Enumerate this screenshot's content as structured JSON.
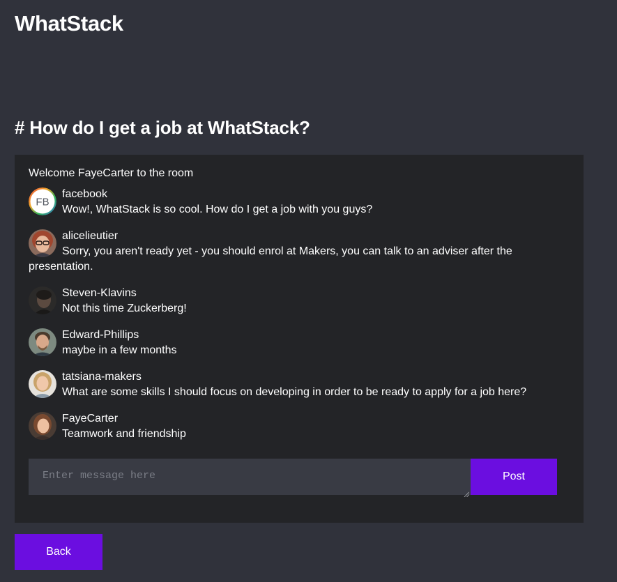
{
  "app": {
    "title": "WhatStack"
  },
  "room": {
    "title": "# How do I get a job at WhatStack?"
  },
  "chat": {
    "welcome": "Welcome FayeCarter to the room",
    "messages": [
      {
        "user": "facebook",
        "text": "Wow!, WhatStack is so cool. How do I get a job with you guys?",
        "avatar": "fb-logo-avatar",
        "avatar_text": "FB"
      },
      {
        "user": "alicelieutier",
        "text": "Sorry, you aren't ready yet - you should enrol at Makers, you can talk to an adviser after the presentation.",
        "avatar": "user-photo-avatar"
      },
      {
        "user": "Steven-Klavins",
        "text": "Not this time Zuckerberg!",
        "avatar": "user-photo-avatar"
      },
      {
        "user": "Edward-Phillips",
        "text": "maybe in a few months",
        "avatar": "user-photo-avatar"
      },
      {
        "user": "tatsiana-makers",
        "text": "What are some skills I should focus on developing in order to be ready to apply for a job here?",
        "avatar": "user-photo-avatar"
      },
      {
        "user": "FayeCarter",
        "text": "Teamwork and friendship",
        "avatar": "user-photo-avatar"
      }
    ]
  },
  "composer": {
    "placeholder": "Enter message here",
    "value": "",
    "post_label": "Post"
  },
  "nav": {
    "back_label": "Back"
  },
  "colors": {
    "background": "#30323b",
    "panel": "#232427",
    "input": "#393b44",
    "accent": "#6b0ee0"
  }
}
